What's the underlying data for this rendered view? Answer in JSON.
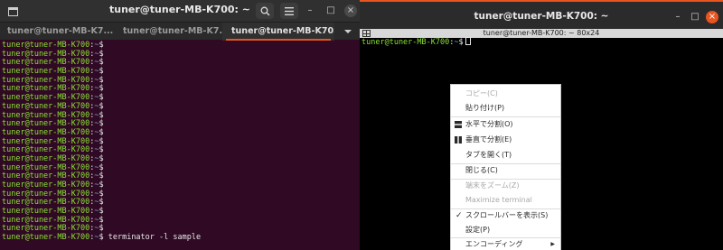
{
  "left_window": {
    "title": "tuner@tuner-MB-K700: ~",
    "icons": {
      "new_tab": "new-tab-icon",
      "search": "search-icon",
      "menu": "hamburger-menu-icon"
    },
    "window_buttons": {
      "minimize": "–",
      "maximize": "□",
      "close": "×"
    },
    "tabs": [
      {
        "label": "tuner@tuner-MB-K7..."
      },
      {
        "label": "tuner@tuner-MB-K7..."
      },
      {
        "label": "tuner@tuner-MB-K70..."
      }
    ],
    "prompt": {
      "user_host": "tuner@tuner-MB-K700",
      "colon": ":",
      "dir": "~",
      "symbol": "$"
    },
    "prompt_lines_count": 23,
    "last_command": " terminator -l sample"
  },
  "right_window": {
    "title": "tuner@tuner-MB-K700: ~",
    "window_buttons": {
      "minimize": "–",
      "maximize": "□",
      "close": "×"
    },
    "terminal_bar_title": "tuner@tuner-MB-K700: ~ 80x24",
    "prompt": {
      "user_host": "tuner@tuner-MB-K700",
      "colon": ":",
      "dir": "~",
      "symbol": "$"
    }
  },
  "context_menu": {
    "items": [
      {
        "label": "コピー(C)",
        "enabled": false
      },
      {
        "label": "貼り付け(P)",
        "enabled": true
      },
      {
        "label": "水平で分割(O)",
        "enabled": true,
        "icon": "split-horizontal-icon"
      },
      {
        "label": "垂直で分割(E)",
        "enabled": true,
        "icon": "split-vertical-icon"
      },
      {
        "label": "タブを開く(T)",
        "enabled": true
      },
      {
        "label": "閉じる(C)",
        "enabled": true
      },
      {
        "label": "端末をズーム(Z)",
        "enabled": false
      },
      {
        "label": "Maximize terminal",
        "enabled": false
      },
      {
        "label": "スクロールバーを表示(S)",
        "enabled": true,
        "checked": true,
        "check_mark": "✓"
      },
      {
        "label": "設定(P)",
        "enabled": true
      },
      {
        "label": "エンコーディング",
        "enabled": true,
        "submenu_arrow": "▶"
      }
    ]
  },
  "colors": {
    "left_terminal_bg": "#300a24",
    "prompt_user": "#8ae234",
    "prompt_dir": "#729fcf",
    "accent": "#e95420",
    "right_terminal_bg": "#000000"
  }
}
